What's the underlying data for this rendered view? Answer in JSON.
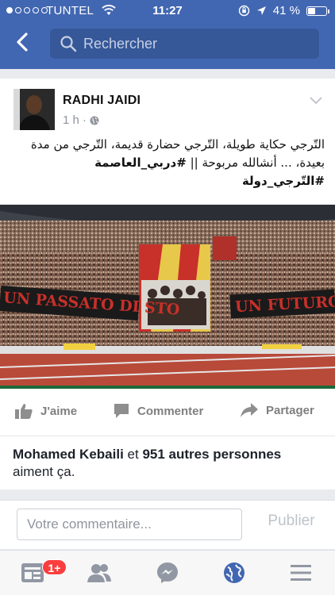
{
  "status_bar": {
    "carrier": "TUNTEL",
    "time": "11:27",
    "battery_text": "41 %",
    "battery_level": 0.41
  },
  "search": {
    "placeholder": "Rechercher"
  },
  "post": {
    "author": "RADHI JAIDI",
    "time": "1 h",
    "text_line": "التّرجي حكاية طويلة، التّرجي حضارة قديمة، التّرجي من مدة بعيدة، ... أنشالله مربوحة ||",
    "hashtag1": "#دربي_العاصمة",
    "hashtag2": "#التّرجي_دولة",
    "banner_left": "UN PASSATO DI STO",
    "banner_right": "UN FUTURO"
  },
  "actions": {
    "like": "J'aime",
    "comment": "Commenter",
    "share": "Partager"
  },
  "likes": {
    "name": "Mohamed Kebaili",
    "and": " et ",
    "others": "951 autres personnes",
    "suffix": "aiment ça."
  },
  "comment_box": {
    "placeholder": "Votre commentaire...",
    "publish": "Publier"
  },
  "tabbar": {
    "badge": "1+"
  },
  "colors": {
    "brand": "#4267b2",
    "search_bg": "#365899",
    "active_tab": "#4267b2",
    "badge": "#fa3e3e"
  }
}
